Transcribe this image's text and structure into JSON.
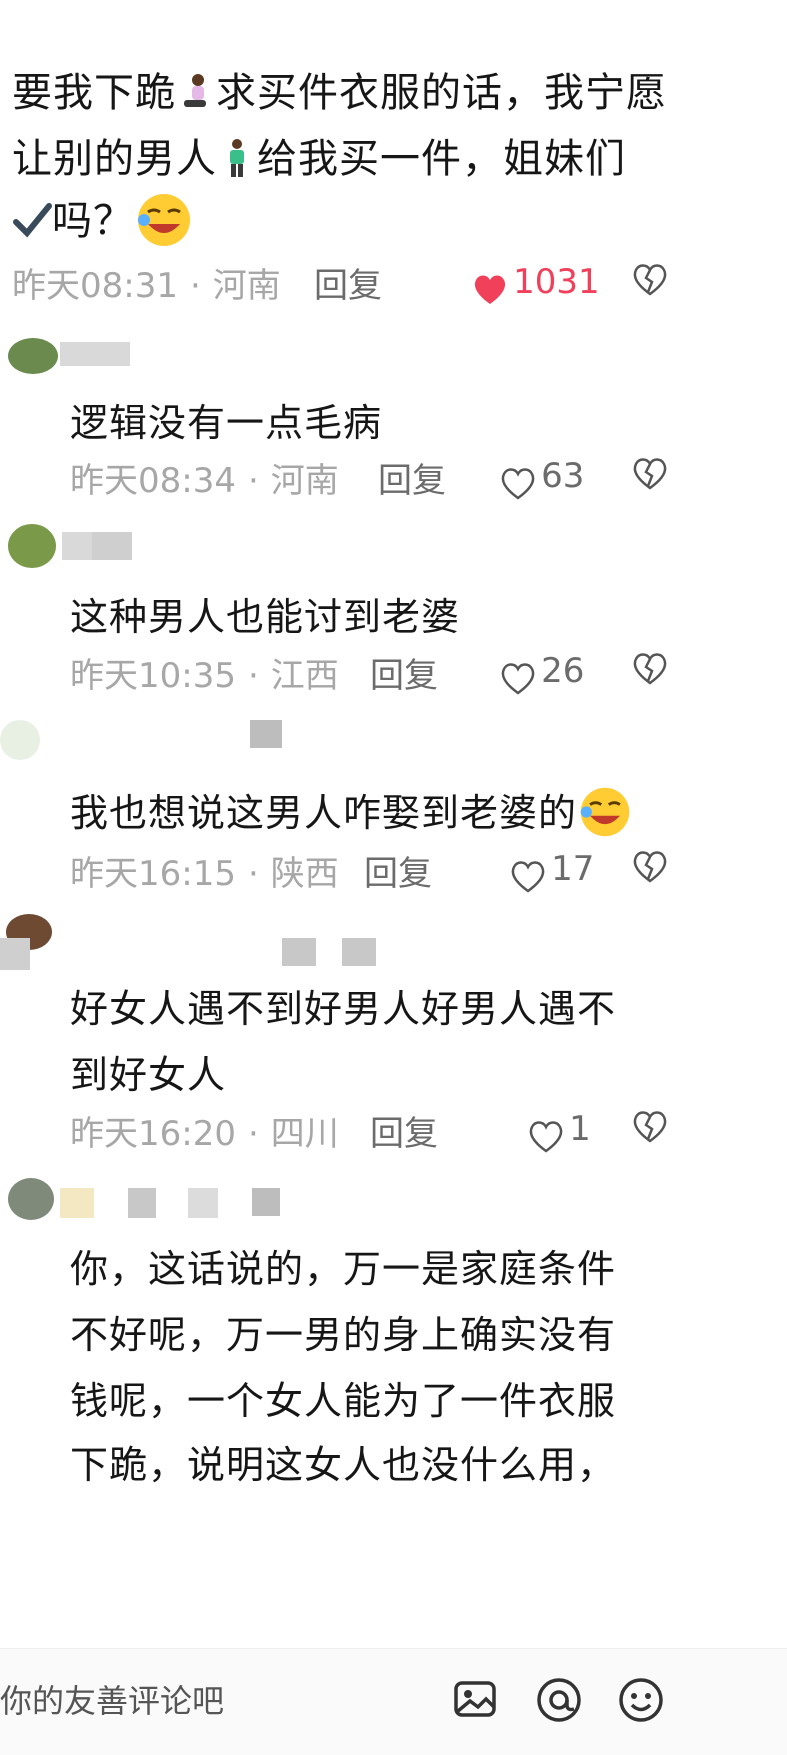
{
  "top_comment": {
    "line1": "要我下跪",
    "line1b": "求买件衣服的话，我宁愿",
    "line2": "让别的男人",
    "line2b": "给我买一件，姐妹们",
    "line3b": "吗？",
    "time": "昨天08:31",
    "location": "河南",
    "reply": "回复",
    "likes": "1031"
  },
  "replies": [
    {
      "text": "逻辑没有一点毛病",
      "time": "昨天08:34",
      "location": "河南",
      "reply": "回复",
      "likes": "63"
    },
    {
      "text": "这种男人也能讨到老婆",
      "time": "昨天10:35",
      "location": "江西",
      "reply": "回复",
      "likes": "26"
    },
    {
      "text": "我也想说这男人咋娶到老婆的",
      "time": "昨天16:15",
      "location": "陕西",
      "reply": "回复",
      "likes": "17"
    },
    {
      "text1": "好女人遇不到好男人好男人遇不",
      "text2": "到好女人",
      "time": "昨天16:20",
      "location": "四川",
      "reply": "回复",
      "likes": "1"
    },
    {
      "text1": "你，这话说的，万一是家庭条件",
      "text2": "不好呢，万一男的身上确实没有",
      "text3": "钱呢，一个女人能为了一件衣服",
      "text4": "下跪，说明这女人也没什么用，"
    }
  ],
  "input": {
    "placeholder": "你的友善评论吧"
  },
  "icons": [
    "image-icon",
    "mention-icon",
    "emoji-icon",
    "heart-icon",
    "dislike-icon"
  ],
  "colors": {
    "like_red": "#f0405a",
    "meta_gray": "#a7a7a7"
  }
}
